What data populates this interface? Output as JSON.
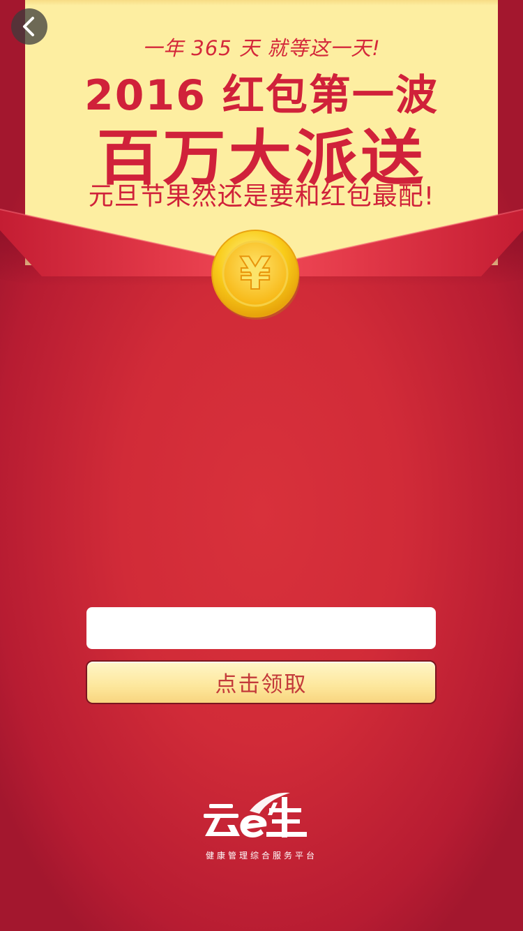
{
  "header": {
    "line1": "一年 365 天  就等这一天!",
    "line2": "2016 红包第一波",
    "line3": "百万大派送",
    "line4": "元旦节果然还是要和红包最配!"
  },
  "coin": {
    "symbol": "¥"
  },
  "form": {
    "phone_value": "",
    "phone_placeholder": "",
    "claim_label": "点击领取"
  },
  "footer": {
    "brand_tagline": "健康管理综合服务平台"
  },
  "colors": {
    "envelope_red": "#c91f32",
    "card_yellow": "#fdeea1",
    "headline_red": "#d0213a",
    "coin_gold": "#f9c412"
  }
}
